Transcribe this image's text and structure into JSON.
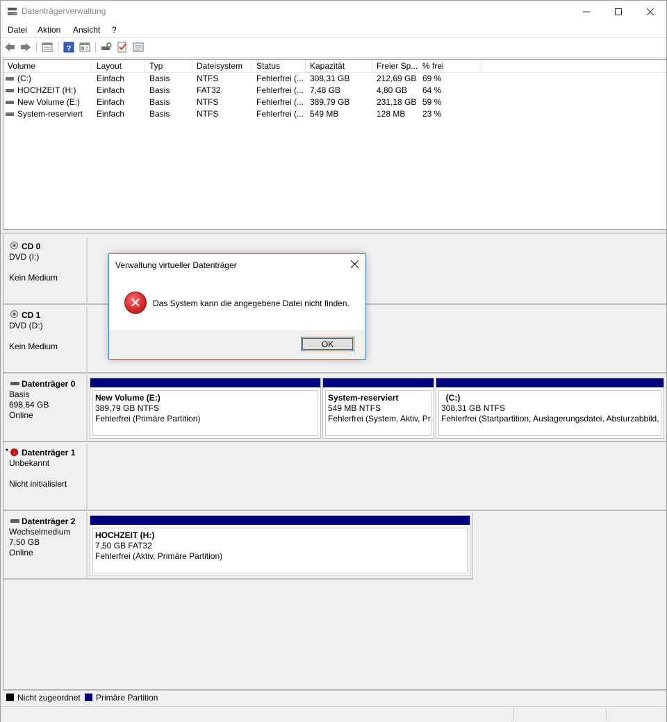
{
  "window": {
    "title": "Datenträgerverwaltung"
  },
  "menu": {
    "items": [
      "Datei",
      "Aktion",
      "Ansicht",
      "?"
    ]
  },
  "toolbar": {
    "icons": [
      "back-icon",
      "forward-icon",
      "list-view-icon",
      "help-icon",
      "properties-icon",
      "rescan-icon",
      "check-icon",
      "settings-icon"
    ]
  },
  "volumes": {
    "columns": [
      "Volume",
      "Layout",
      "Typ",
      "Dateisystem",
      "Status",
      "Kapazität",
      "Freier Sp...",
      "% frei"
    ],
    "rows": [
      [
        "(C:)",
        "Einfach",
        "Basis",
        "NTFS",
        "Fehlerfrei (...",
        "308,31 GB",
        "212,69 GB",
        "69 %"
      ],
      [
        "HOCHZEIT (H:)",
        "Einfach",
        "Basis",
        "FAT32",
        "Fehlerfrei (...",
        "7,48 GB",
        "4,80 GB",
        "64 %"
      ],
      [
        "New Volume (E:)",
        "Einfach",
        "Basis",
        "NTFS",
        "Fehlerfrei (...",
        "389,79 GB",
        "231,18 GB",
        "59 %"
      ],
      [
        "System-reserviert",
        "Einfach",
        "Basis",
        "NTFS",
        "Fehlerfrei (...",
        "549 MB",
        "128 MB",
        "23 %"
      ]
    ]
  },
  "disks": [
    {
      "name": "CD 0",
      "line1": "DVD (I:)",
      "line2": "",
      "line3": "Kein Medium"
    },
    {
      "name": "CD 1",
      "line1": "DVD (D:)",
      "line2": "",
      "line3": "Kein Medium"
    },
    {
      "name": "Datenträger 0",
      "line1": "Basis",
      "line2": "698,64 GB",
      "line3": "Online",
      "partitions": [
        {
          "name": "New Volume  (E:)",
          "size": "389,79 GB NTFS",
          "status": "Fehlerfrei (Primäre Partition)"
        },
        {
          "name": "System-reserviert",
          "size": "549 MB NTFS",
          "status": "Fehlerfrei (System, Aktiv, Pri"
        },
        {
          "name": "  (C:)",
          "size": "308,31 GB NTFS",
          "status": "Fehlerfrei (Startpartition, Auslagerungsdatei, Absturzabbild,"
        }
      ]
    },
    {
      "name": "Datenträger 1",
      "prefix": "*",
      "line1": "Unbekannt",
      "line2": "",
      "line3": "Nicht initialisiert"
    },
    {
      "name": "Datenträger 2",
      "line1": "Wechselmedium",
      "line2": "7,50 GB",
      "line3": "Online",
      "partitions": [
        {
          "name": "HOCHZEIT  (H:)",
          "size": "7,50 GB FAT32",
          "status": "Fehlerfrei (Aktiv, Primäre Partition)"
        }
      ]
    }
  ],
  "legend": [
    {
      "label": "Nicht zugeordnet",
      "color": "#000000"
    },
    {
      "label": "Primäre Partition",
      "color": "#00007f"
    }
  ],
  "dialog": {
    "title": "Verwaltung virtueller Datenträger",
    "message": "Das System kann die angegebene Datei nicht finden.",
    "ok_label": "OK"
  }
}
